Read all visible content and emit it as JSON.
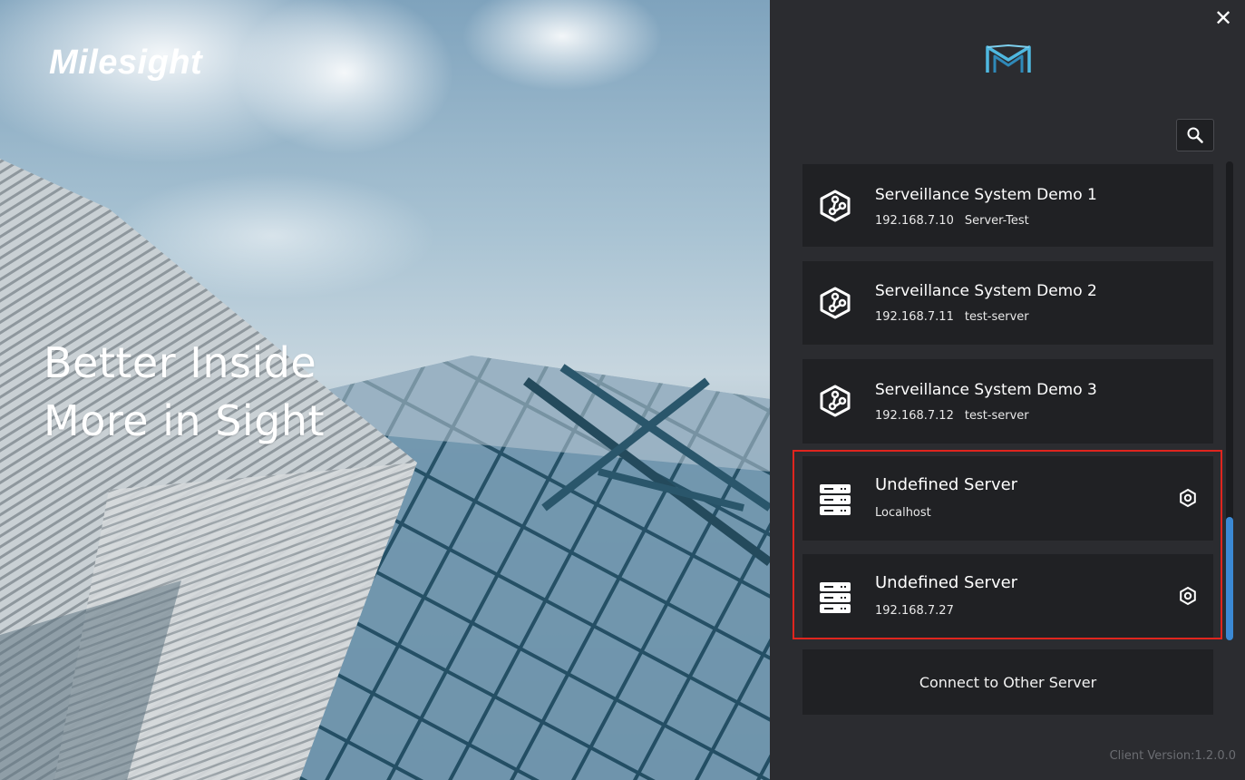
{
  "hero": {
    "brand": "Milesight",
    "tagline_line1": "Better Inside",
    "tagline_line2": "More in Sight"
  },
  "panel": {
    "close_icon": "close-icon",
    "logo_icon": "milesight-m-logo",
    "search_icon": "search-icon",
    "servers": [
      {
        "name": "Serveillance System Demo 1",
        "ip": "192.168.7.10",
        "tag": "Server-Test",
        "icon": "cube-network-icon"
      },
      {
        "name": "Serveillance System Demo 2",
        "ip": "192.168.7.11",
        "tag": "test-server",
        "icon": "cube-network-icon"
      },
      {
        "name": "Serveillance System Demo 3",
        "ip": "192.168.7.12",
        "tag": "test-server",
        "icon": "cube-network-icon"
      },
      {
        "name": "Undefined Server",
        "ip": "Localhost",
        "tag": "",
        "icon": "server-rack-icon"
      },
      {
        "name": "Undefined Server",
        "ip": "192.168.7.27",
        "tag": "",
        "icon": "server-rack-icon"
      }
    ],
    "connect_label": "Connect to Other Server",
    "version": "Client Version:1.2.0.0"
  },
  "colors": {
    "panel_bg": "#2b2c30",
    "card_bg": "#202124",
    "highlight": "#e0251e",
    "scroll_thumb": "#3b89d4",
    "logo_accent": "#4fb8e0"
  }
}
